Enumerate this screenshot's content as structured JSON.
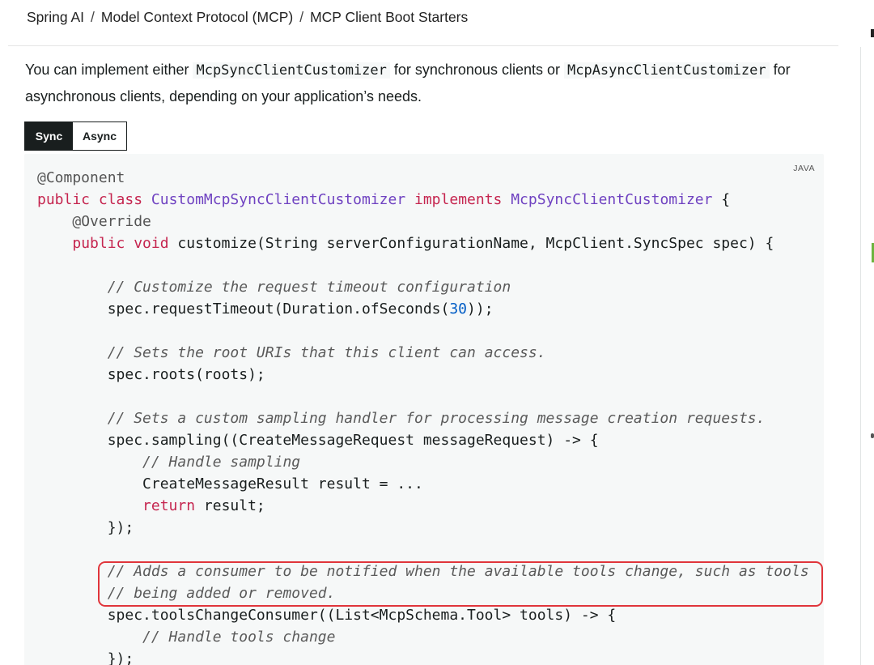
{
  "breadcrumb": {
    "items": [
      "Spring AI",
      "Model Context Protocol (MCP)",
      "MCP Client Boot Starters"
    ],
    "separator": "/"
  },
  "intro": {
    "prefix": "You can implement either ",
    "code1": "McpSyncClientCustomizer",
    "middle": " for synchronous clients or ",
    "code2": "McpAsyncClientCustomizer",
    "suffix": " for asynchronous clients, depending on your application’s needs."
  },
  "tabs": [
    {
      "label": "Sync",
      "active": true
    },
    {
      "label": "Async",
      "active": false
    }
  ],
  "code": {
    "language": "JAVA",
    "lines": [
      [
        {
          "t": "an",
          "v": "@Component"
        }
      ],
      [
        {
          "t": "kw",
          "v": "public class "
        },
        {
          "t": "ty",
          "v": "CustomMcpSyncClientCustomizer"
        },
        {
          "t": "kw",
          "v": " implements "
        },
        {
          "t": "ty",
          "v": "McpSyncClientCustomizer"
        },
        {
          "t": "",
          "v": " {"
        }
      ],
      [
        {
          "t": "",
          "v": "    "
        },
        {
          "t": "an",
          "v": "@Override"
        }
      ],
      [
        {
          "t": "",
          "v": "    "
        },
        {
          "t": "kw",
          "v": "public void "
        },
        {
          "t": "",
          "v": "customize(String serverConfigurationName, McpClient.SyncSpec spec) {"
        }
      ],
      [
        {
          "t": "",
          "v": ""
        }
      ],
      [
        {
          "t": "",
          "v": "        "
        },
        {
          "t": "cm",
          "v": "// Customize the request timeout configuration"
        }
      ],
      [
        {
          "t": "",
          "v": "        spec.requestTimeout(Duration.ofSeconds("
        },
        {
          "t": "nm",
          "v": "30"
        },
        {
          "t": "",
          "v": "));"
        }
      ],
      [
        {
          "t": "",
          "v": ""
        }
      ],
      [
        {
          "t": "",
          "v": "        "
        },
        {
          "t": "cm",
          "v": "// Sets the root URIs that this client can access."
        }
      ],
      [
        {
          "t": "",
          "v": "        spec.roots(roots);"
        }
      ],
      [
        {
          "t": "",
          "v": ""
        }
      ],
      [
        {
          "t": "",
          "v": "        "
        },
        {
          "t": "cm",
          "v": "// Sets a custom sampling handler for processing message creation requests."
        }
      ],
      [
        {
          "t": "",
          "v": "        spec.sampling((CreateMessageRequest messageRequest) -> {"
        }
      ],
      [
        {
          "t": "",
          "v": "            "
        },
        {
          "t": "cm",
          "v": "// Handle sampling"
        }
      ],
      [
        {
          "t": "",
          "v": "            CreateMessageResult result = ..."
        }
      ],
      [
        {
          "t": "",
          "v": "            "
        },
        {
          "t": "kw",
          "v": "return "
        },
        {
          "t": "",
          "v": "result;"
        }
      ],
      [
        {
          "t": "",
          "v": "        });"
        }
      ],
      [
        {
          "t": "",
          "v": ""
        }
      ],
      [
        {
          "t": "",
          "v": "        "
        },
        {
          "t": "cm",
          "v": "// Adds a consumer to be notified when the available tools change, such as tools"
        }
      ],
      [
        {
          "t": "",
          "v": "        "
        },
        {
          "t": "cm",
          "v": "// being added or removed."
        }
      ],
      [
        {
          "t": "",
          "v": "        spec.toolsChangeConsumer((List<McpSchema.Tool> tools) -> {"
        }
      ],
      [
        {
          "t": "",
          "v": "            "
        },
        {
          "t": "cm",
          "v": "// Handle tools change"
        }
      ],
      [
        {
          "t": "",
          "v": "        });"
        }
      ]
    ]
  },
  "colors": {
    "highlight_border": "#e0353b",
    "keyword": "#c5254f",
    "type": "#6f42c1",
    "code_background": "#f6f8f8",
    "tab_active_bg": "#191e1e",
    "rail_accent": "#6db33f"
  }
}
